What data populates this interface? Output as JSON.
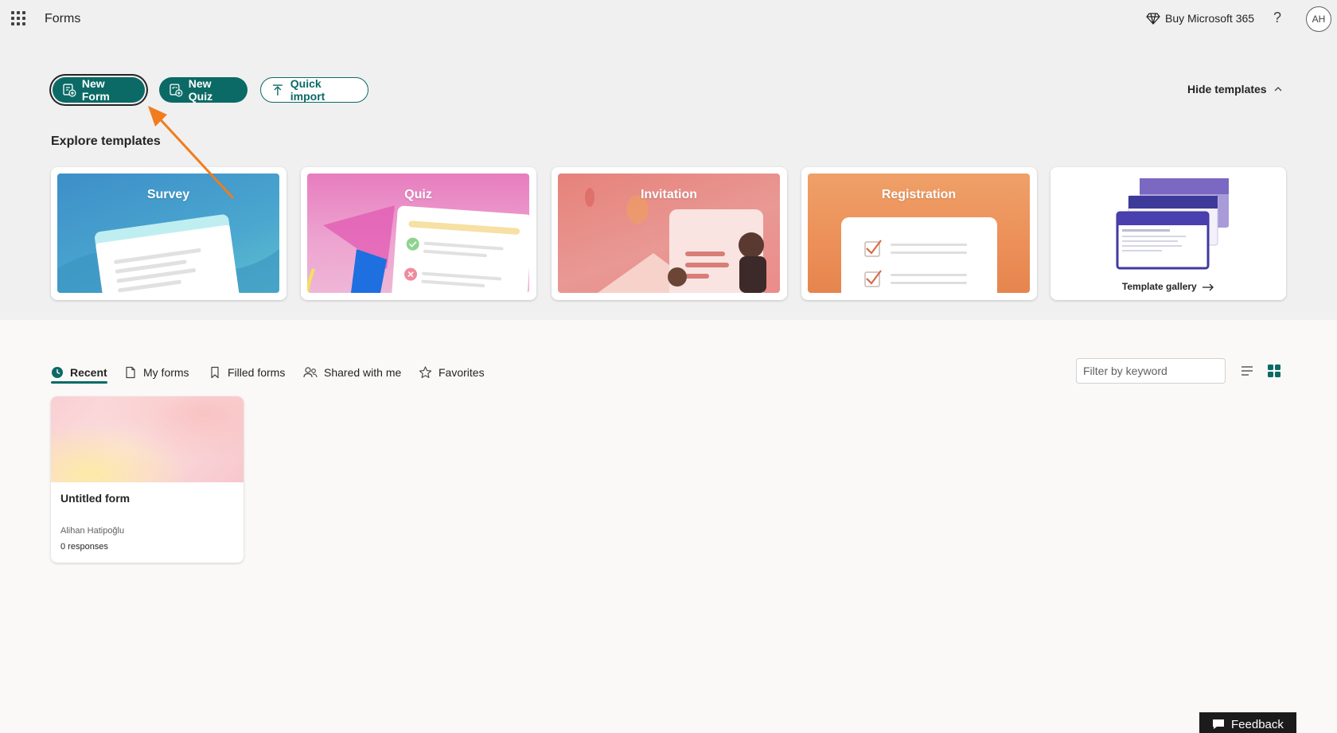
{
  "header": {
    "app_title": "Forms",
    "buy_label": "Buy Microsoft 365",
    "help_label": "?",
    "avatar_initials": "AH"
  },
  "actions": {
    "new_form": "New Form",
    "new_quiz": "New Quiz",
    "quick_import": "Quick import",
    "hide_templates": "Hide templates"
  },
  "templates": {
    "section_title": "Explore templates",
    "cards": [
      {
        "label": "Survey"
      },
      {
        "label": "Quiz"
      },
      {
        "label": "Invitation"
      },
      {
        "label": "Registration"
      },
      {
        "label": "Template gallery"
      }
    ]
  },
  "tabs": [
    {
      "label": "Recent",
      "icon": "clock-icon",
      "active": true
    },
    {
      "label": "My forms",
      "icon": "document-icon"
    },
    {
      "label": "Filled forms",
      "icon": "bookmark-icon"
    },
    {
      "label": "Shared with me",
      "icon": "people-icon"
    },
    {
      "label": "Favorites",
      "icon": "star-icon"
    }
  ],
  "filter": {
    "placeholder": "Filter by keyword"
  },
  "forms": [
    {
      "title": "Untitled form",
      "owner": "Alihan Hatipoğlu",
      "responses": "0 responses"
    }
  ],
  "feedback_label": "Feedback",
  "colors": {
    "accent": "#0b6a66",
    "annotation_arrow": "#f07c1e"
  }
}
